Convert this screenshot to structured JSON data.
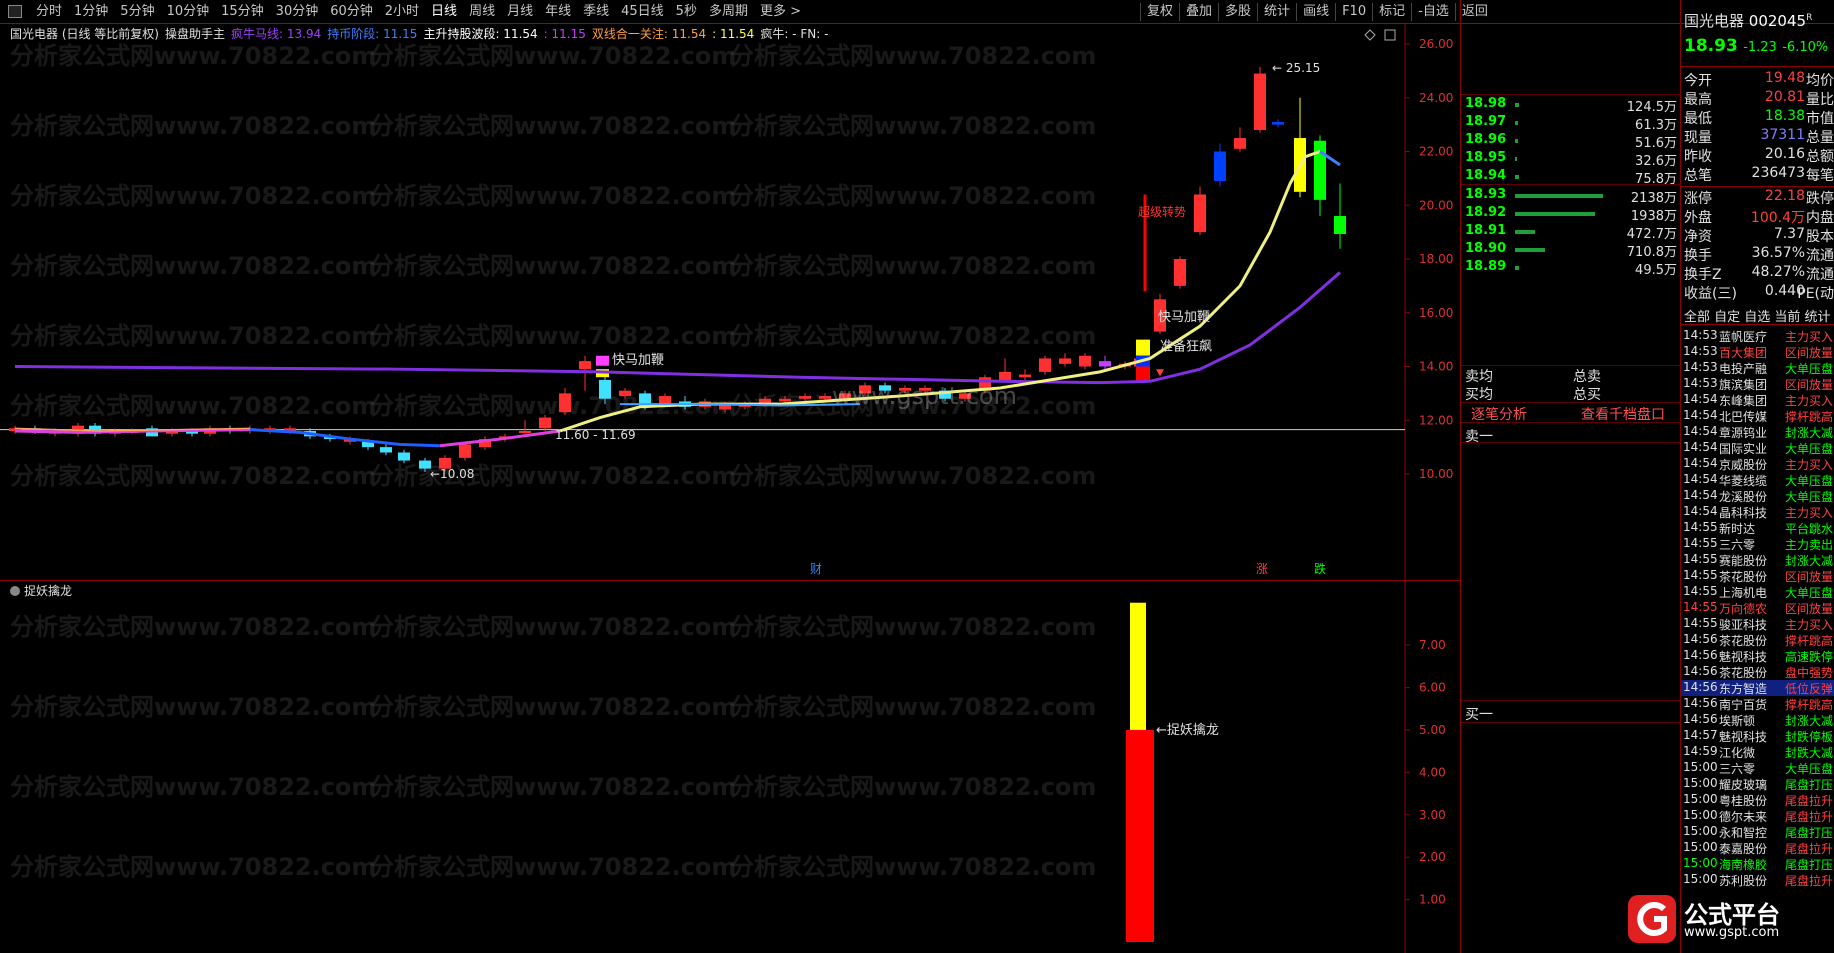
{
  "toolbar": {
    "periods": [
      "分时",
      "1分钟",
      "5分钟",
      "10分钟",
      "15分钟",
      "30分钟",
      "60分钟",
      "2小时",
      "日线",
      "周线",
      "月线",
      "年线",
      "季线",
      "45日线",
      "5秒",
      "多周期",
      "更多 >"
    ],
    "tools": [
      "复权",
      "叠加",
      "多股",
      "统计",
      "画线",
      "F10",
      "标记",
      "-自选",
      "返回"
    ]
  },
  "info_line": {
    "stock": "国光电器 (日线 等比前复权)",
    "indicator": "操盘助手主",
    "a_label": "疯牛马线: 13.94",
    "b_label": "持币阶段: 11.15",
    "c_label": "主升持股波段: 11.54",
    "d_label": ": 11.15",
    "e_label": "双线合一关注: 11.54",
    "f_label": ": 11.54",
    "g_label": "疯牛: -  FN: -"
  },
  "sub_title": "捉妖擒龙",
  "chart_data": {
    "type": "candlestick",
    "y_axis_main": [
      26.0,
      24.0,
      22.0,
      20.0,
      18.0,
      16.0,
      14.0,
      12.0,
      10.0
    ],
    "y_axis_sub": [
      7.0,
      6.0,
      5.0,
      4.0,
      3.0,
      2.0,
      1.0
    ],
    "annotations": [
      "25.15",
      "11.60 - 11.69",
      "10.08",
      "快马加鞭",
      "快马加鞭",
      "准备狂飙",
      "超级转势",
      "捉妖擒龙",
      "财",
      "涨",
      "跌"
    ],
    "watermark": "分析家公式网www.70822.com",
    "watermark2": "www.gsptt.com"
  },
  "order_book": {
    "asks": [
      {
        "price": "18.98",
        "vol": "124.5万"
      },
      {
        "price": "18.97",
        "vol": "61.3万"
      },
      {
        "price": "18.96",
        "vol": "51.6万"
      },
      {
        "price": "18.95",
        "vol": "32.6万"
      },
      {
        "price": "18.94",
        "vol": "75.8万"
      }
    ],
    "bids": [
      {
        "price": "18.93",
        "vol": "2138万"
      },
      {
        "price": "18.92",
        "vol": "1938万"
      },
      {
        "price": "18.91",
        "vol": "472.7万"
      },
      {
        "price": "18.90",
        "vol": "710.8万"
      },
      {
        "price": "18.89",
        "vol": "49.5万"
      }
    ],
    "sell_avg": "卖均",
    "buy_avg": "买均",
    "total_sell": "总卖",
    "total_buy": "总买",
    "detail_link": "逐笔分析",
    "depth_link": "查看千档盘口",
    "sell_one": "卖一",
    "buy_one": "买一"
  },
  "stock": {
    "name": "国光电器",
    "code": "002045",
    "flag": "R",
    "price": "18.93",
    "change": "-1.23",
    "pct": "-6.10%",
    "rows": [
      {
        "l": "今开",
        "v": "19.48",
        "r": "均价",
        "c": "#ff4040"
      },
      {
        "l": "最高",
        "v": "20.81",
        "r": "量比",
        "c": "#ff4040"
      },
      {
        "l": "最低",
        "v": "18.38",
        "r": "市值",
        "c": "#00ff00"
      },
      {
        "l": "现量",
        "v": "37311",
        "r": "总量",
        "c": "#8080ff"
      },
      {
        "l": "昨收",
        "v": "20.16",
        "r": "总额",
        "c": "#e0e0e0"
      },
      {
        "l": "总笔",
        "v": "236473",
        "r": "每笔",
        "c": "#e0e0e0"
      },
      {
        "l": "涨停",
        "v": "22.18",
        "r": "跌停",
        "c": "#ff4040"
      },
      {
        "l": "外盘",
        "v": "100.4万",
        "r": "内盘",
        "c": "#ff4040"
      },
      {
        "l": "净资",
        "v": "7.37",
        "r": "股本",
        "c": "#e0e0e0"
      },
      {
        "l": "换手",
        "v": "36.57%",
        "r": "流通",
        "c": "#e0e0e0"
      },
      {
        "l": "换手Z",
        "v": "48.27%",
        "r": "流通",
        "c": "#e0e0e0"
      },
      {
        "l": "收益(三)",
        "v": "0.440",
        "r": "PE(动",
        "c": "#e0e0e0"
      }
    ],
    "tabs": "全部 自定 自选 当前 统计"
  },
  "tickers": [
    {
      "t": "14:53",
      "n": "蓝帆医疗",
      "a": "主力买入",
      "c": "#ff4040"
    },
    {
      "t": "14:53",
      "n": "百大集团",
      "a": "区间放量",
      "c": "#ff4040",
      "nc": "#ff4040"
    },
    {
      "t": "14:53",
      "n": "电投产融",
      "a": "大单压盘",
      "c": "#00ff00"
    },
    {
      "t": "14:53",
      "n": "旗滨集团",
      "a": "区间放量",
      "c": "#ff4040"
    },
    {
      "t": "14:54",
      "n": "东峰集团",
      "a": "主力买入",
      "c": "#ff4040"
    },
    {
      "t": "14:54",
      "n": "北巴传媒",
      "a": "撑杆跳高",
      "c": "#ff4040"
    },
    {
      "t": "14:54",
      "n": "章源钨业",
      "a": "封涨大减",
      "c": "#00ff00"
    },
    {
      "t": "14:54",
      "n": "国际实业",
      "a": "大单压盘",
      "c": "#00ff00"
    },
    {
      "t": "14:54",
      "n": "京威股份",
      "a": "主力买入",
      "c": "#ff4040"
    },
    {
      "t": "14:54",
      "n": "华菱线缆",
      "a": "大单压盘",
      "c": "#00ff00"
    },
    {
      "t": "14:54",
      "n": "龙溪股份",
      "a": "大单压盘",
      "c": "#00ff00"
    },
    {
      "t": "14:54",
      "n": "晶科科技",
      "a": "主力买入",
      "c": "#ff4040"
    },
    {
      "t": "14:55",
      "n": "新时达",
      "a": "平台跳水",
      "c": "#00ff00"
    },
    {
      "t": "14:55",
      "n": "三六零",
      "a": "主力卖出",
      "c": "#00ff00"
    },
    {
      "t": "14:55",
      "n": "赛能股份",
      "a": "封涨大减",
      "c": "#00ff00"
    },
    {
      "t": "14:55",
      "n": "茶花股份",
      "a": "区间放量",
      "c": "#ff4040"
    },
    {
      "t": "14:55",
      "n": "上海机电",
      "a": "大单压盘",
      "c": "#00ff00"
    },
    {
      "t": "14:55",
      "n": "万向德农",
      "a": "区间放量",
      "c": "#ff4040",
      "tc": "#ff4040",
      "nc": "#ff4040"
    },
    {
      "t": "14:55",
      "n": "骏亚科技",
      "a": "主力买入",
      "c": "#ff4040"
    },
    {
      "t": "14:56",
      "n": "茶花股份",
      "a": "撑杆跳高",
      "c": "#ff4040"
    },
    {
      "t": "14:56",
      "n": "魅视科技",
      "a": "高速跌停",
      "c": "#00ff00"
    },
    {
      "t": "14:56",
      "n": "茶花股份",
      "a": "盘中强势",
      "c": "#ff4040"
    },
    {
      "t": "14:56",
      "n": "东方智造",
      "a": "低位反弹",
      "c": "#ff4040",
      "hl": true
    },
    {
      "t": "14:56",
      "n": "南宁百货",
      "a": "撑杆跳高",
      "c": "#ff4040"
    },
    {
      "t": "14:56",
      "n": "埃斯顿",
      "a": "封涨大减",
      "c": "#00ff00"
    },
    {
      "t": "14:57",
      "n": "魅视科技",
      "a": "封跌停板",
      "c": "#00ff00"
    },
    {
      "t": "14:59",
      "n": "江化微",
      "a": "封跌大减",
      "c": "#00ff00"
    },
    {
      "t": "15:00",
      "n": "三六零",
      "a": "大单压盘",
      "c": "#00ff00"
    },
    {
      "t": "15:00",
      "n": "耀皮玻璃",
      "a": "尾盘打压",
      "c": "#00ff00"
    },
    {
      "t": "15:00",
      "n": "粤桂股份",
      "a": "尾盘拉升",
      "c": "#ff4040"
    },
    {
      "t": "15:00",
      "n": "德尔未来",
      "a": "尾盘拉升",
      "c": "#ff4040"
    },
    {
      "t": "15:00",
      "n": "永和智控",
      "a": "尾盘打压",
      "c": "#00ff00"
    },
    {
      "t": "15:00",
      "n": "泰嘉股份",
      "a": "尾盘拉升",
      "c": "#ff4040"
    },
    {
      "t": "15:00",
      "n": "海南橡胶",
      "a": "尾盘打压",
      "c": "#00ff00",
      "tc": "#00ff00",
      "nc": "#00ff00"
    },
    {
      "t": "15:00",
      "n": "苏利股份",
      "a": "尾盘拉升",
      "c": "#ff4040"
    }
  ],
  "logo": {
    "text": "公式平台",
    "url": "www.gspt.com"
  }
}
